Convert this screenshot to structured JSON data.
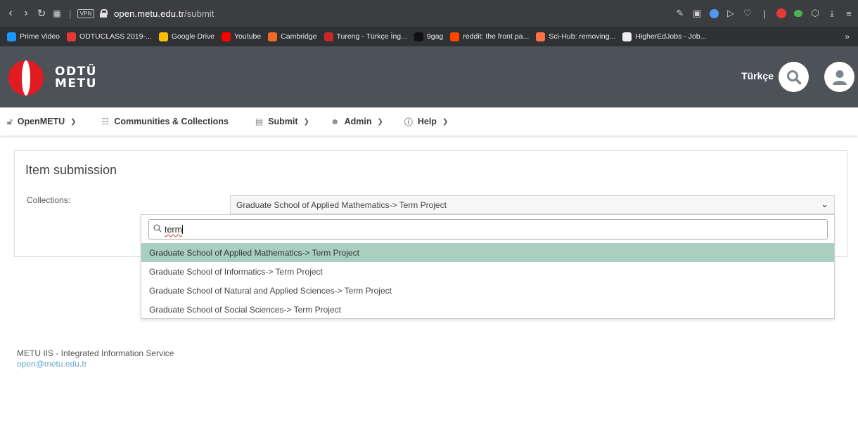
{
  "browser": {
    "url_host": "open.metu.edu.tr",
    "url_path": "/submit",
    "vpn_label": "VPN",
    "bookmarks": [
      {
        "label": "Prime Video",
        "color": "#1a98ff"
      },
      {
        "label": "ODTUCLASS 2019-...",
        "color": "#e53935"
      },
      {
        "label": "Google Drive",
        "color": "#fbbc04"
      },
      {
        "label": "Youtube",
        "color": "#ff0000"
      },
      {
        "label": "Cambridge",
        "color": "#f06a25"
      },
      {
        "label": "Tureng - Türkçe İng...",
        "color": "#c62828"
      },
      {
        "label": "9gag",
        "color": "#111111"
      },
      {
        "label": "reddit: the front pa...",
        "color": "#ff4500"
      },
      {
        "label": "Sci-Hub: removing...",
        "color": "#ff7043"
      },
      {
        "label": "HigherEdJobs - Job...",
        "color": "#eeeeee"
      }
    ]
  },
  "header": {
    "logo_line1": "ODTÜ",
    "logo_line2": "METU",
    "language": "Türkçe"
  },
  "nav": [
    {
      "label": "OpenMETU",
      "icon": "unlock-icon",
      "caret": true
    },
    {
      "label": "Communities & Collections",
      "icon": "sitemap-icon",
      "caret": false
    },
    {
      "label": "Submit",
      "icon": "file-import-icon",
      "caret": true
    },
    {
      "label": "Admin",
      "icon": "users-cog-icon",
      "caret": true
    },
    {
      "label": "Help",
      "icon": "info-circle-icon",
      "caret": true
    }
  ],
  "submission": {
    "title": "Item submission",
    "collections_label": "Collections:",
    "selected_value": "Graduate School of Applied Mathematics-> Term Project"
  },
  "dropdown": {
    "search_value": "term",
    "options": [
      "Graduate School of Applied Mathematics-> Term Project",
      "Graduate School of Informatics-> Term Project",
      "Graduate School of Natural and Applied Sciences-> Term Project",
      "Graduate School of Social Sciences-> Term Project"
    ],
    "highlighted_index": 0
  },
  "footer": {
    "line1": "METU IIS - Integrated Information Service",
    "email": "open@metu.edu.tr"
  }
}
